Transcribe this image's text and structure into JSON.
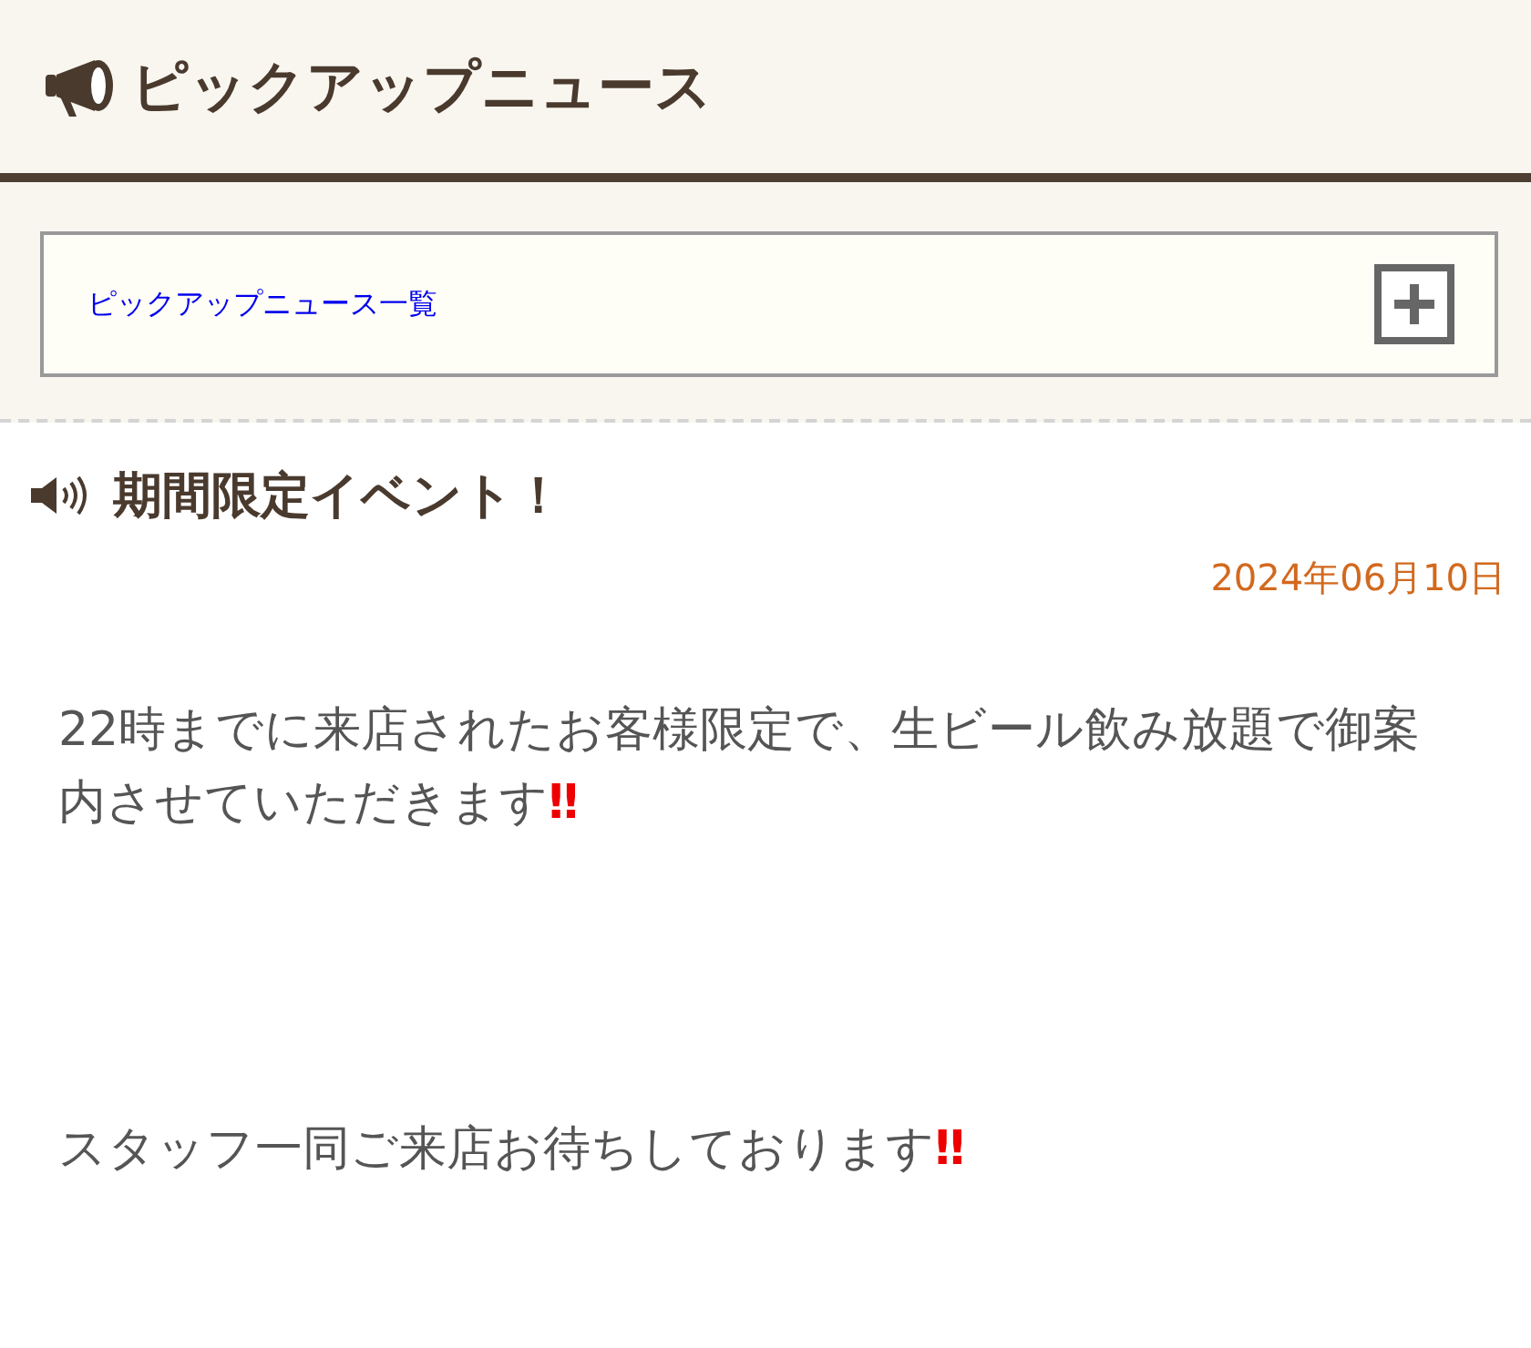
{
  "header": {
    "title": "ピックアップニュース"
  },
  "list_link": {
    "label": "ピックアップニュース一覧"
  },
  "article": {
    "title": "期間限定イベント！",
    "date": "2024年06月10日",
    "paragraphs": [
      {
        "text": "22時までに来店されたお客様限定で、生ビール飲み放題で御案内させていただきます",
        "emphasis": "‼"
      },
      {
        "text": "スタッフ一同ご来店お待ちしております",
        "emphasis": "‼"
      }
    ]
  }
}
